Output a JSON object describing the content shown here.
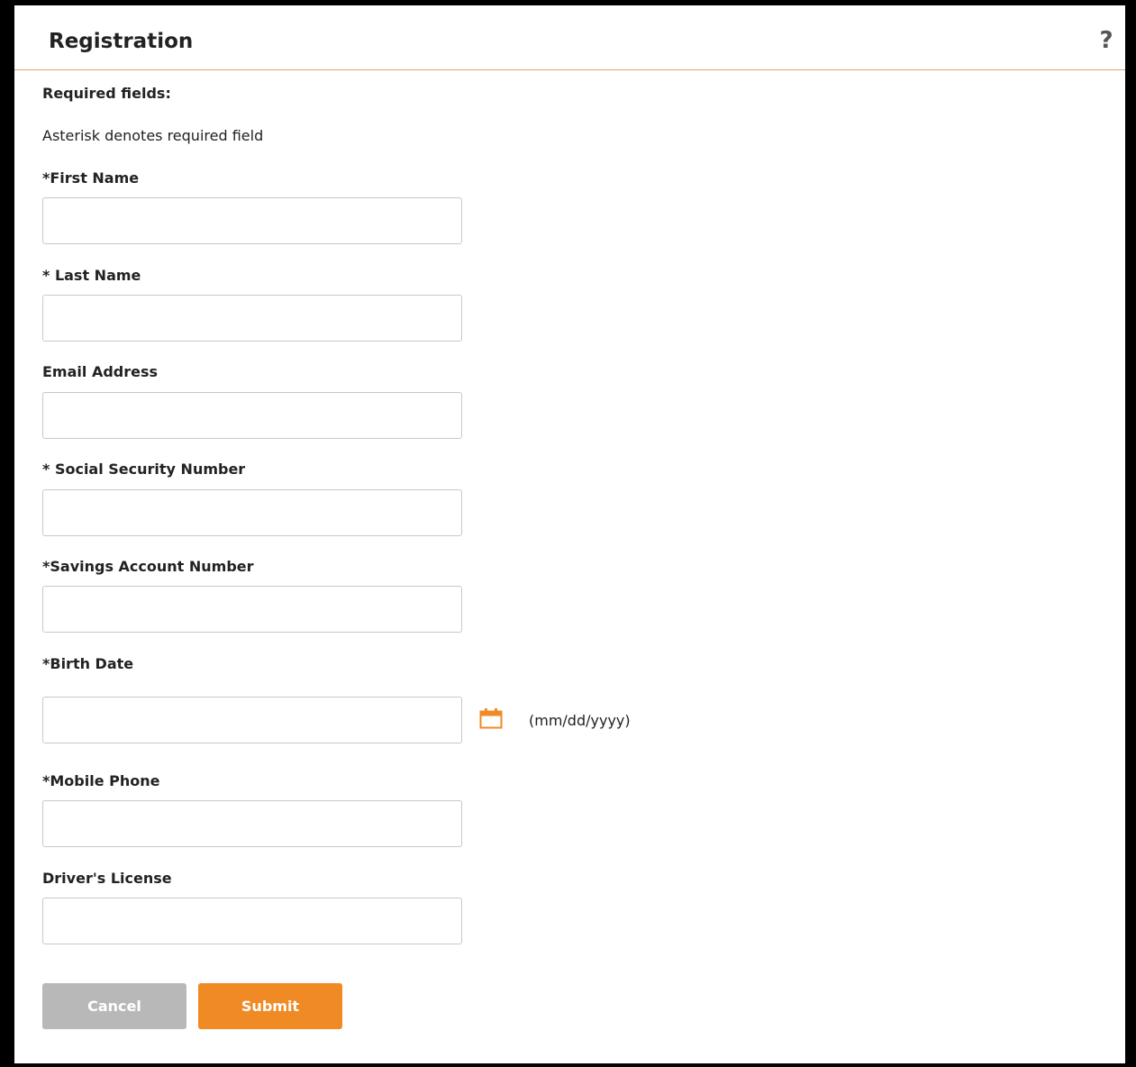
{
  "header": {
    "title": "Registration",
    "help_label": "?"
  },
  "form": {
    "required_heading": "Required fields:",
    "required_note": "Asterisk denotes required field",
    "fields": [
      {
        "label": "*First Name",
        "value": "",
        "placeholder": ""
      },
      {
        "label": "* Last Name",
        "value": "",
        "placeholder": ""
      },
      {
        "label": "Email Address",
        "value": "",
        "placeholder": ""
      },
      {
        "label": "* Social Security Number",
        "value": "",
        "placeholder": ""
      },
      {
        "label": "*Savings Account Number",
        "value": "",
        "placeholder": ""
      },
      {
        "label": "*Birth Date",
        "value": "",
        "placeholder": ""
      },
      {
        "label": "*Mobile Phone",
        "value": "",
        "placeholder": ""
      },
      {
        "label": "Driver's License",
        "value": "",
        "placeholder": ""
      }
    ],
    "birth_date_format_hint": "(mm/dd/yyyy)",
    "calendar_icon": "calendar-icon"
  },
  "actions": {
    "cancel_label": "Cancel",
    "submit_label": "Submit"
  },
  "colors": {
    "accent": "#f08a24",
    "cancel_bg": "#b8b8b8",
    "header_rule": "#f0a060"
  }
}
